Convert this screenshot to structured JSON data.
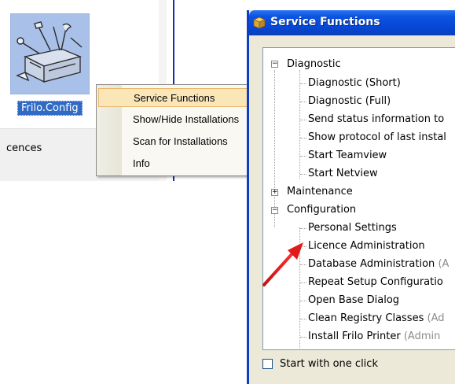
{
  "desktop": {
    "icon_name": "tools-icon",
    "icon_label": "Frilo.Config",
    "partial_text": "cences"
  },
  "context_menu": {
    "items": [
      {
        "label": "Service Functions",
        "highlighted": true
      },
      {
        "label": "Show/Hide Installations",
        "highlighted": false
      },
      {
        "label": "Scan for Installations",
        "highlighted": false
      },
      {
        "label": "Info",
        "highlighted": false
      }
    ]
  },
  "window": {
    "title": "Service Functions",
    "title_icon": "package-icon",
    "tree": {
      "diagnostic": {
        "label": "Diagnostic",
        "state": "expanded",
        "children": [
          {
            "label": "Diagnostic (Short)"
          },
          {
            "label": "Diagnostic (Full)"
          },
          {
            "label": "Send status information to"
          },
          {
            "label": "Show protocol of last instal"
          },
          {
            "label": "Start Teamview"
          },
          {
            "label": "Start Netview"
          }
        ]
      },
      "maintenance": {
        "label": "Maintenance",
        "state": "collapsed"
      },
      "configuration": {
        "label": "Configuration",
        "state": "expanded",
        "children": [
          {
            "label": "Personal Settings",
            "suffix": ""
          },
          {
            "label": "Licence Administration",
            "suffix": ""
          },
          {
            "label": "Database Administration",
            "suffix": "(A"
          },
          {
            "label": "Repeat Setup Configuratio",
            "suffix": ""
          },
          {
            "label": "Open Base Dialog",
            "suffix": ""
          },
          {
            "label": "Clean Registry Classes",
            "suffix": "(Ad"
          },
          {
            "label": "Install Frilo Printer",
            "suffix": "(Admin"
          }
        ]
      }
    },
    "start_with_one_click": {
      "label": "Start with one click",
      "checked": false
    }
  },
  "annotation": {
    "arrow_color": "#e01b1b"
  },
  "colors": {
    "titlebar": "#0a4ed8",
    "selection": "#316ac5",
    "menu_highlight": "#fbe6b8"
  }
}
